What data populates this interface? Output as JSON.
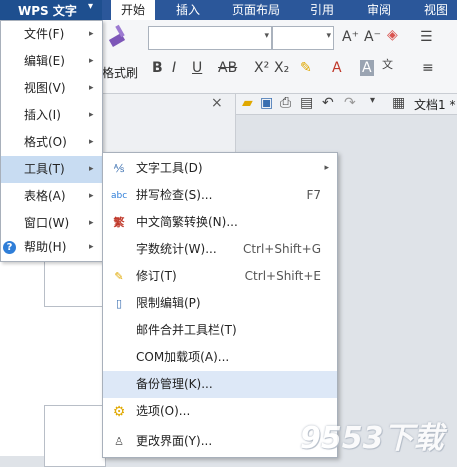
{
  "app": {
    "menu_button_label": "WPS 文字"
  },
  "tabs": [
    {
      "label": "开始",
      "active": true
    },
    {
      "label": "插入"
    },
    {
      "label": "页面布局"
    },
    {
      "label": "引用"
    },
    {
      "label": "审阅"
    },
    {
      "label": "视图"
    }
  ],
  "ribbon": {
    "format_brush_label": "格式刷"
  },
  "document": {
    "title": "文档1 *",
    "close_glyph": "×"
  },
  "main_menu": [
    {
      "label": "文件(F)"
    },
    {
      "label": "编辑(E)"
    },
    {
      "label": "视图(V)"
    },
    {
      "label": "插入(I)"
    },
    {
      "label": "格式(O)"
    },
    {
      "label": "工具(T)",
      "active": true
    },
    {
      "label": "表格(A)"
    },
    {
      "label": "窗口(W)"
    },
    {
      "label": "帮助(H)"
    }
  ],
  "tools_submenu": [
    {
      "label": "文字工具(D)",
      "shortcut": "",
      "icon": "text-tools-icon",
      "has_submenu": true
    },
    {
      "label": "拼写检查(S)...",
      "shortcut": "F7",
      "icon": "spell-check-icon"
    },
    {
      "label": "中文简繁转换(N)...",
      "shortcut": "",
      "icon": "chinese-convert-icon"
    },
    {
      "label": "字数统计(W)...",
      "shortcut": "Ctrl+Shift+G",
      "icon": ""
    },
    {
      "label": "修订(T)",
      "shortcut": "Ctrl+Shift+E",
      "icon": "revision-icon"
    },
    {
      "label": "限制编辑(P)",
      "shortcut": "",
      "icon": "restrict-edit-icon"
    },
    {
      "label": "邮件合并工具栏(T)",
      "shortcut": "",
      "icon": ""
    },
    {
      "label": "COM加载项(A)...",
      "shortcut": "",
      "icon": ""
    },
    {
      "label": "备份管理(K)...",
      "shortcut": "",
      "icon": "",
      "highlighted": true
    },
    {
      "label": "选项(O)...",
      "shortcut": "",
      "icon": "options-gear-icon"
    },
    {
      "label": "更改界面(Y)...",
      "shortcut": "",
      "icon": "change-ui-icon"
    }
  ],
  "watermark": "9553下载"
}
